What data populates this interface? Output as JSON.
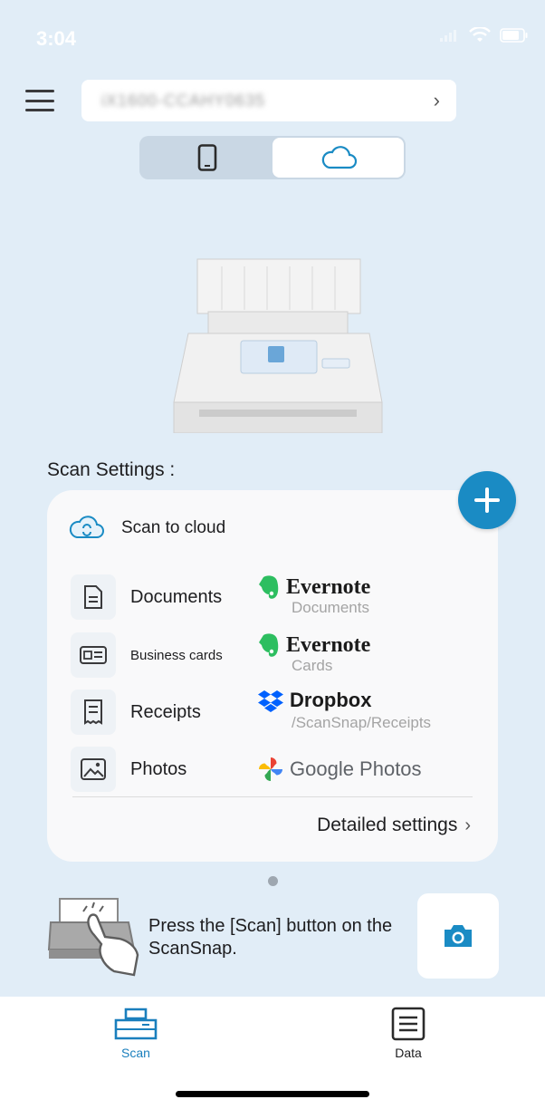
{
  "status_bar": {
    "time": "3:04"
  },
  "header": {
    "device_name": "iX1600-CCAHY0635",
    "segment": {
      "active": "cloud"
    }
  },
  "scan_settings": {
    "title": "Scan Settings :",
    "profile": {
      "label": "Scan to cloud"
    },
    "rows": [
      {
        "label": "Documents",
        "icon": "document-icon",
        "destination": "Evernote",
        "sub": "Documents"
      },
      {
        "label": "Business cards",
        "icon": "business-card-icon",
        "destination": "Evernote",
        "sub": "Cards"
      },
      {
        "label": "Receipts",
        "icon": "receipt-icon",
        "destination": "Dropbox",
        "sub": "/ScanSnap/Receipts"
      },
      {
        "label": "Photos",
        "icon": "photo-icon",
        "destination": "Google Photos",
        "sub": ""
      }
    ],
    "detailed_settings": "Detailed settings"
  },
  "hint": {
    "text": "Press the [Scan] button on the ScanSnap."
  },
  "tabs": [
    {
      "label": "Scan",
      "active": true
    },
    {
      "label": "Data",
      "active": false
    }
  ],
  "colors": {
    "accent": "#1a8bc4",
    "background": "#e1edf7",
    "card": "#f9f9fa"
  }
}
